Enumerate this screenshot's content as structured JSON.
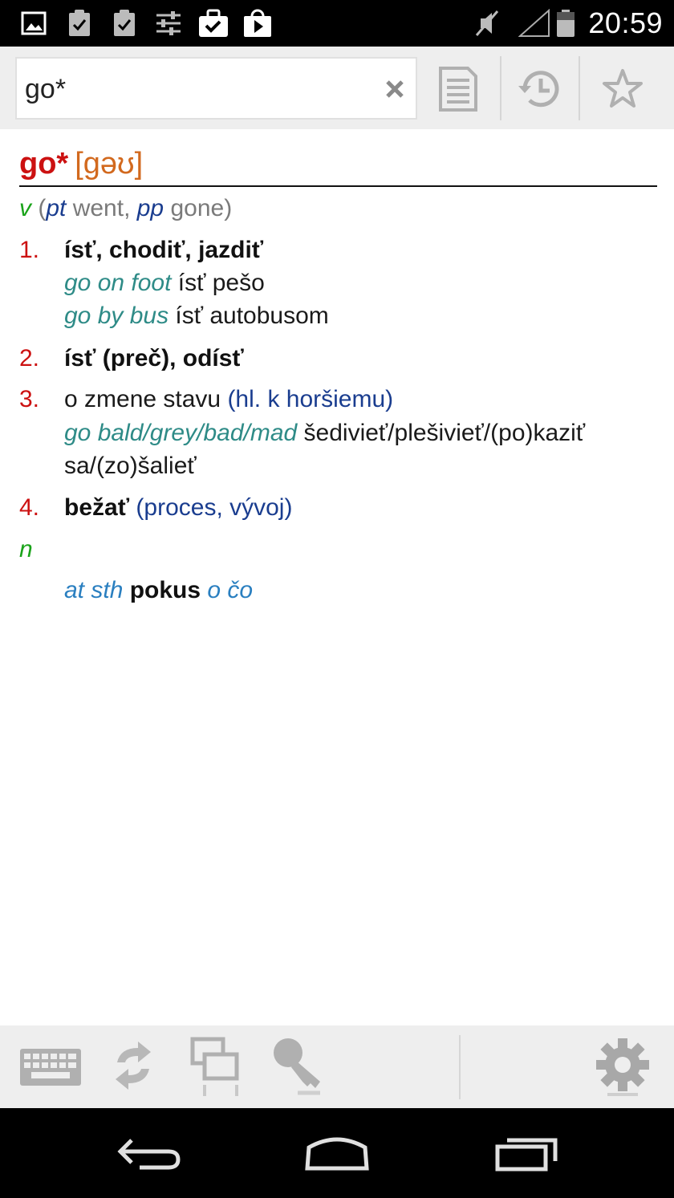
{
  "status_bar": {
    "time": "20:59",
    "icons": [
      "image-icon",
      "clipboard-check-icon",
      "clipboard-check-icon",
      "sliders-icon",
      "briefcase-check-icon",
      "play-bag-icon",
      "mute-icon",
      "signal-icon",
      "battery-icon"
    ]
  },
  "search": {
    "value": "go*",
    "clear_icon": "close-icon"
  },
  "toolbar": {
    "icons": [
      "document-icon",
      "history-icon",
      "star-icon"
    ]
  },
  "entry": {
    "headword": "go*",
    "pronunciation": "[gəʊ]",
    "verb": {
      "pos": "v",
      "paren_open": "(",
      "pt_abbr": "pt",
      "pt_form": " went, ",
      "pp_abbr": "pp",
      "pp_form": " gone)"
    },
    "senses": [
      {
        "num": "1.",
        "main": "ísť, chodiť, jazdiť",
        "examples": [
          {
            "phrase": "go on foot",
            "translation": " ísť pešo"
          },
          {
            "phrase": "go by bus",
            "translation": " ísť autobusom"
          }
        ]
      },
      {
        "num": "2.",
        "main": "ísť (preč), odísť"
      },
      {
        "num": "3.",
        "main_plain": "o zmene stavu ",
        "note": "(hl. k horšiemu)",
        "examples": [
          {
            "phrase": "go bald/grey/bad/mad",
            "translation": " šedivieť/plešivieť/(po)kaziť",
            "continuation": "sa/(zo)šalieť"
          }
        ]
      },
      {
        "num": "4.",
        "main": "bežať",
        "note": " (proces, vývoj)"
      }
    ],
    "noun": {
      "pos": "n",
      "phrase_a": "at sth",
      "translation": " pokus ",
      "phrase_b": "o čo"
    }
  },
  "bottom_toolbar": {
    "icons": [
      "keyboard-icon",
      "swap-icon",
      "windows-icon",
      "key-icon",
      "gear-icon"
    ]
  },
  "nav_bar": {
    "icons": [
      "back-icon",
      "home-icon",
      "recents-icon"
    ]
  }
}
